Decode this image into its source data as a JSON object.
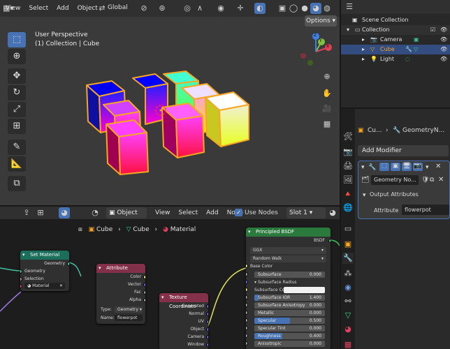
{
  "viewport": {
    "menu": [
      "View",
      "Select",
      "Add",
      "Object"
    ],
    "orientation": "Global",
    "options_label": "Options",
    "perspective": "User Perspective",
    "context": "(1) Collection | Cube",
    "axes": {
      "x": "X",
      "y": "Y",
      "z": "Z"
    }
  },
  "outliner": {
    "root": "Scene Collection",
    "collection": "Collection",
    "items": [
      "Camera",
      "Cube",
      "Light"
    ]
  },
  "properties": {
    "breadcrumb_object": "Cu...",
    "breadcrumb_modifier": "GeometryN...",
    "add_modifier": "Add Modifier",
    "modifier_name": "Geometry No...",
    "output_attributes": "Output Attributes",
    "attribute_label": "Attribute",
    "attribute_value": "flowerpot"
  },
  "node_editor": {
    "mode": "Object",
    "menu": [
      "View",
      "Select",
      "Add",
      "Node"
    ],
    "use_nodes": "Use Nodes",
    "slot": "Slot 1",
    "breadcrumb": [
      "Cube",
      "Cube",
      "Material"
    ],
    "set_material": {
      "title": "Set Material",
      "geometry_out": "Geometry",
      "geometry_in": "Geometry",
      "selection": "Selection",
      "material": "Material"
    },
    "attribute": {
      "title": "Attribute",
      "outputs": [
        "Color",
        "Vector",
        "Fac",
        "Alpha"
      ],
      "type_label": "Type:",
      "type_value": "Geometry",
      "name_label": "Name:",
      "name_value": "flowerpot"
    },
    "texture_coordinate": {
      "title": "Texture Coordinate",
      "outputs": [
        "Generated",
        "Normal",
        "UV",
        "Object",
        "Camera",
        "Window"
      ]
    },
    "principled": {
      "title": "Principled BSDF",
      "bsdf": "BSDF",
      "distribution": "GGX",
      "subsurface_method": "Random Walk",
      "base_color": "Base Color",
      "rows": [
        {
          "label": "Subsurface",
          "value": "0.000"
        },
        {
          "label": "Subsurface Radius",
          "value": ""
        },
        {
          "label": "Subsurface Co...",
          "value": ""
        },
        {
          "label": "Subsurface IOR",
          "value": "1.400"
        },
        {
          "label": "Subsurface Anisotropy",
          "value": "0.000"
        },
        {
          "label": "Metallic",
          "value": "0.000"
        },
        {
          "label": "Specular",
          "value": "0.500",
          "fill": 0.5
        },
        {
          "label": "Specular Tint",
          "value": "0.000"
        },
        {
          "label": "Roughness",
          "value": "0.400",
          "fill": 0.4
        },
        {
          "label": "Anisotropic",
          "value": "0.000"
        }
      ]
    }
  },
  "colors": {
    "accent": "#4772b3",
    "selected": "#f5a623",
    "set_material_header": "#1a6e5a",
    "attribute_header": "#83314a",
    "principled_header": "#2b7a3d"
  }
}
